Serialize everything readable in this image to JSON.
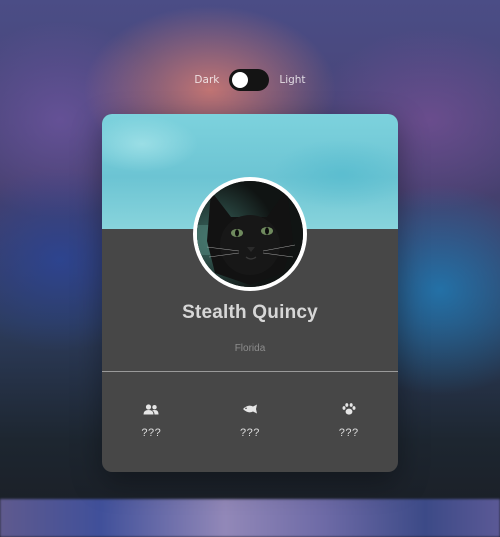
{
  "theme_toggle": {
    "dark_label": "Dark",
    "light_label": "Light",
    "state": "dark"
  },
  "profile": {
    "name": "Stealth Quincy",
    "location": "Florida",
    "avatar": "black-cat-photo"
  },
  "stats": [
    {
      "icon": "users-icon",
      "value": "???"
    },
    {
      "icon": "fish-icon",
      "value": "???"
    },
    {
      "icon": "paw-icon",
      "value": "???"
    }
  ],
  "colors": {
    "card_bg": "#474747",
    "banner": "#6cc4d3",
    "toggle_track": "#141414",
    "text_name": "#d7d7d7",
    "text_location": "#8d8d8d"
  }
}
